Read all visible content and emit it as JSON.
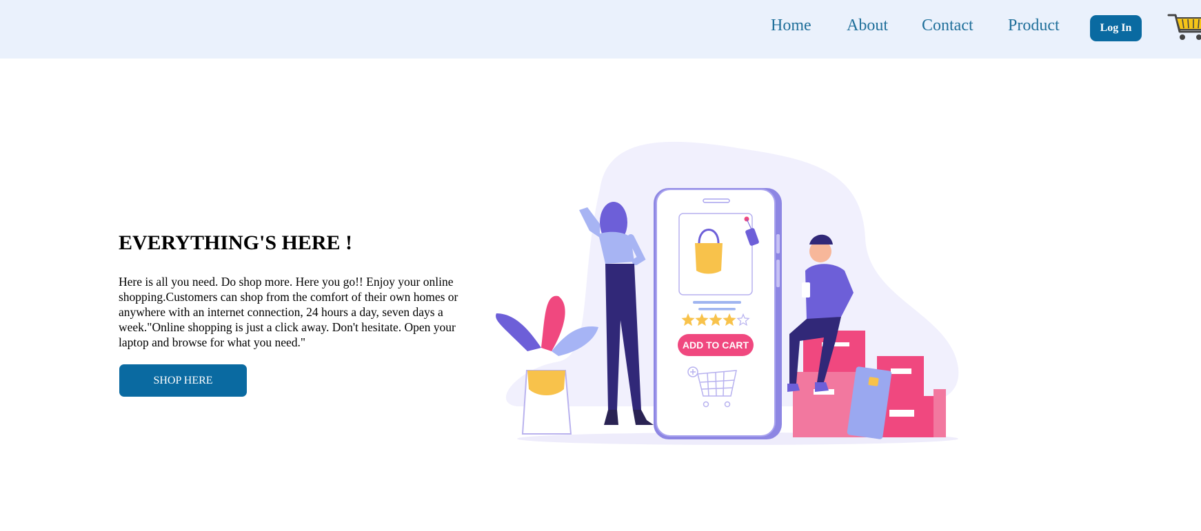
{
  "nav": {
    "links": [
      "Home",
      "About",
      "Contact",
      "Product"
    ],
    "login_label": "Log In",
    "cart_icon": "shopping-cart-icon"
  },
  "hero": {
    "title": "EVERYTHING'S HERE !",
    "text": "Here is all you need. Do shop more. Here you go!! Enjoy your online shopping.Customers can shop from the comfort of their own homes or anywhere with an internet connection, 24 hours a day, seven days a week.\"Online shopping is just a click away. Don't hesitate. Open your laptop and browse for what you need.\"",
    "button_label": "SHOP HERE"
  },
  "illustration": {
    "button_label": "ADD TO CART",
    "rating": 4,
    "rating_max": 5
  },
  "colors": {
    "topbar_bg": "#eaf1fc",
    "nav_link": "#1f6f9a",
    "primary_button": "#0a6aa1",
    "accent_pink": "#f0487f",
    "accent_purple": "#6f5ce4",
    "accent_yellow": "#f8c24b"
  }
}
